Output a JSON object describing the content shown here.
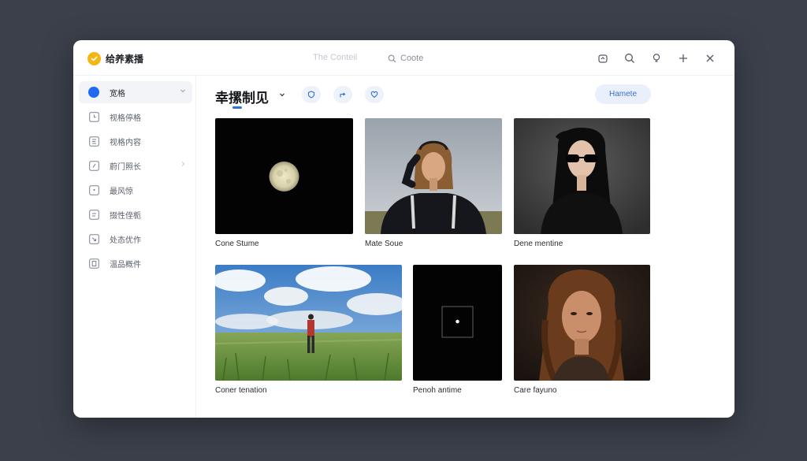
{
  "app": {
    "title": "给养素播",
    "context_label": "The Conteil",
    "search_label": "Coote"
  },
  "titlebar_icons": [
    "share-icon",
    "search-icon",
    "bulb-icon",
    "plus-icon",
    "close-icon"
  ],
  "sidebar": {
    "items": [
      {
        "label": "宽格",
        "icon": "circle-icon",
        "active": true
      },
      {
        "label": "视格停格",
        "icon": "clock-icon",
        "active": false
      },
      {
        "label": "视格内容",
        "icon": "frame-icon",
        "active": false
      },
      {
        "label": "蔚门照长",
        "icon": "edit-icon",
        "active": false
      },
      {
        "label": "最风惊",
        "icon": "dot-box-icon",
        "active": false
      },
      {
        "label": "掇性侄栀",
        "icon": "list-icon",
        "active": false
      },
      {
        "label": "处态优作",
        "icon": "arrow-box-icon",
        "active": false
      },
      {
        "label": "温品概件",
        "icon": "doc-icon",
        "active": false
      }
    ]
  },
  "toolbar": {
    "title": "幸摞制见",
    "home_label": "Hamete"
  },
  "gallery": {
    "items": [
      {
        "caption": "Cone Stume",
        "image": "moon-photo"
      },
      {
        "caption": "Mate Soue",
        "image": "woman-headphones-photo"
      },
      {
        "caption": "Dene mentine",
        "image": "woman-sunglasses-photo"
      },
      {
        "caption": "Coner tenation",
        "image": "field-landscape-photo"
      },
      {
        "caption": "Penoh antime",
        "image": "dark-square-photo"
      },
      {
        "caption": "Care fayuno",
        "image": "portrait-photo"
      }
    ]
  },
  "colors": {
    "background": "#3b404b",
    "accent": "#2f6fe0",
    "logo": "#f4b614",
    "active_item": "#1f6af0"
  }
}
